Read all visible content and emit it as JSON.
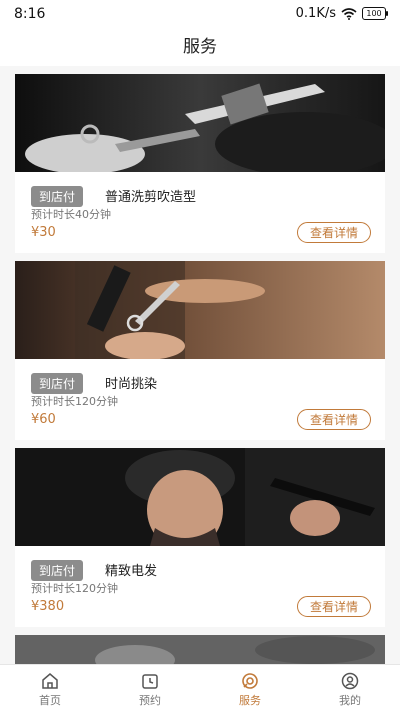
{
  "status": {
    "time": "8:16",
    "network": "0.1K/s",
    "battery": "100"
  },
  "header": {
    "title": "服务"
  },
  "services": [
    {
      "badge": "到店付",
      "name": "普通洗剪吹造型",
      "duration": "预计时长40分钟",
      "price": "¥30",
      "action": "查看详情",
      "image": "haircut-comb-scissors"
    },
    {
      "badge": "到店付",
      "name": "时尚挑染",
      "duration": "预计时长120分钟",
      "price": "¥60",
      "action": "查看详情",
      "image": "hair-highlight-scissors"
    },
    {
      "badge": "到店付",
      "name": "精致电发",
      "duration": "预计时长120分钟",
      "price": "¥380",
      "action": "查看详情",
      "image": "man-hair-styling"
    }
  ],
  "tabs": [
    {
      "label": "首页",
      "icon": "home-icon",
      "active": false
    },
    {
      "label": "预约",
      "icon": "calendar-clock-icon",
      "active": false
    },
    {
      "label": "服务",
      "icon": "service-icon",
      "active": true
    },
    {
      "label": "我的",
      "icon": "profile-icon",
      "active": false
    }
  ],
  "colors": {
    "accent": "#c17a3a",
    "badge": "#8c8c8c"
  }
}
